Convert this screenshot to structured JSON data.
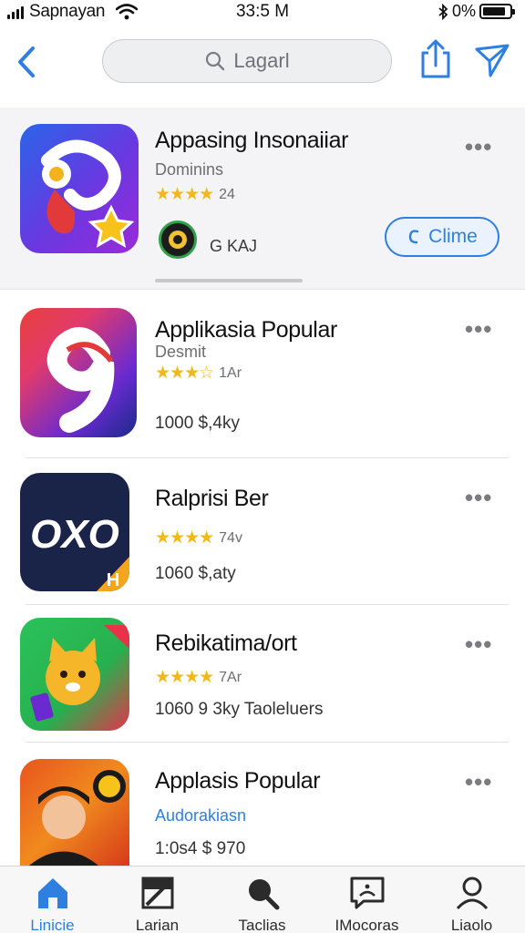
{
  "status_bar": {
    "carrier": "Sapnayan",
    "time": "33:5 M",
    "battery": "0%"
  },
  "nav": {
    "search_placeholder": "Lagarl"
  },
  "featured": {
    "title": "Appasing Insonaiiar",
    "subtitle": "Dominins",
    "stars": "★★★★",
    "rating": "24",
    "developer": "G KAJ",
    "get_label": "Clime",
    "more": "•••"
  },
  "apps": [
    {
      "title": "Applikasia Popular",
      "subtitle": "Desmit",
      "stars": "★★★☆",
      "rating": "1Ar",
      "price": "1000  $,4ky",
      "more": "•••"
    },
    {
      "title": "Ralprisi Ber",
      "subtitle": "",
      "stars": "★★★★",
      "rating": "74v",
      "price": "1060  $,aty",
      "more": "•••"
    },
    {
      "title": "Rebikatima/ort",
      "subtitle": "",
      "stars": "★★★★",
      "rating": "7Ar",
      "price": "1060  9 3ky  Taoleluers",
      "more": "•••"
    },
    {
      "title": "Applasis Popular",
      "subtitle": "Audorakiasn",
      "stars": "",
      "rating": "",
      "price": "1:0s4  $ 970",
      "more": "•••"
    }
  ],
  "tabs": [
    {
      "label": "Linicie",
      "icon": "home-icon"
    },
    {
      "label": "Larian",
      "icon": "edit-icon"
    },
    {
      "label": "Taclias",
      "icon": "search-icon"
    },
    {
      "label": "IMocoras",
      "icon": "message-icon"
    },
    {
      "label": "Liaolo",
      "icon": "person-icon"
    }
  ],
  "colors": {
    "accent": "#2f7fe0",
    "star": "#f2b816"
  }
}
